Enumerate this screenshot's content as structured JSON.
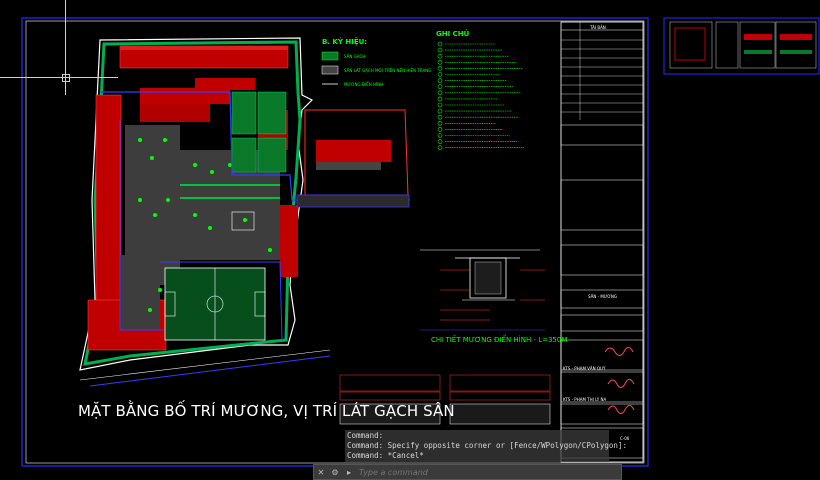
{
  "drawing": {
    "title": "MẶT BẰNG BỐ TRÍ MƯƠNG, VỊ TRÍ LÁT GẠCH SÂN",
    "channel_detail_title": "CHI TIẾT MƯƠNG ĐIỂN HÌNH - L=350M",
    "legend_title": "B. KÝ HIỆU:",
    "legend_items": [
      "SÂN GẠCH",
      "SÂN LÁT GẠCH MỚI TRÊN NỀN HIỆN TRẠNG",
      "MƯƠNG ĐIỂN HÌNH"
    ],
    "notes_title": "GHI CHÚ",
    "note_count": 18
  },
  "title_block": {
    "revision_header": "TÁI BẢN",
    "designer_label": "KTS - PHẠM VĂN QUÝ",
    "checker_label": "KTS - PHẠM THỊ LY NA",
    "sheet_no": "C-06",
    "section_label": "SÂN - MƯƠNG"
  },
  "command_line": {
    "history": [
      "Command:",
      "Command: Specify opposite corner or [Fence/WPolygon/CPolygon]:",
      "Command: *Cancel*"
    ],
    "placeholder": "Type a command"
  },
  "colors": {
    "background": "#000000",
    "building": "#cc0000",
    "grass": "#00b050",
    "text": "#ffffff",
    "accent": "#00ff00",
    "border": "#0000ff"
  }
}
